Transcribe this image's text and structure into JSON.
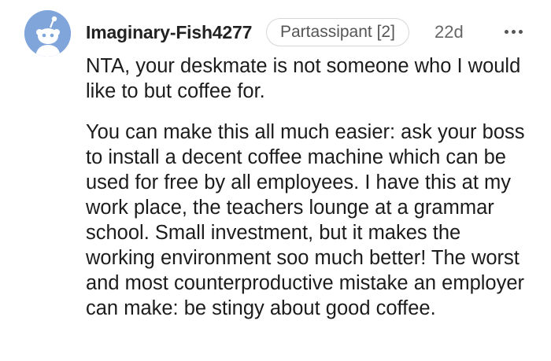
{
  "comment": {
    "author": "Imaginary-Fish4277",
    "flair": "Partassipant [2]",
    "age": "22d",
    "avatar_icon": "reddit-snoo-avatar-icon",
    "more_icon": "more-options-icon",
    "paragraphs": [
      "NTA, your deskmate is not someone who I would like to but coffee for.",
      "You can make this all much easier: ask your boss to install a decent coffee machine which can be used for free by all employees. I have this at my work place, the teachers lounge at a grammar school. Small investment, but it makes the working environment soo much better! The worst and most counterproductive mistake an employer can make: be stingy about good coffee."
    ]
  },
  "colors": {
    "avatar_bg": "#7fa5db",
    "text": "#1c1c1c",
    "meta": "#666666",
    "flair_border": "#d7d7d7"
  }
}
